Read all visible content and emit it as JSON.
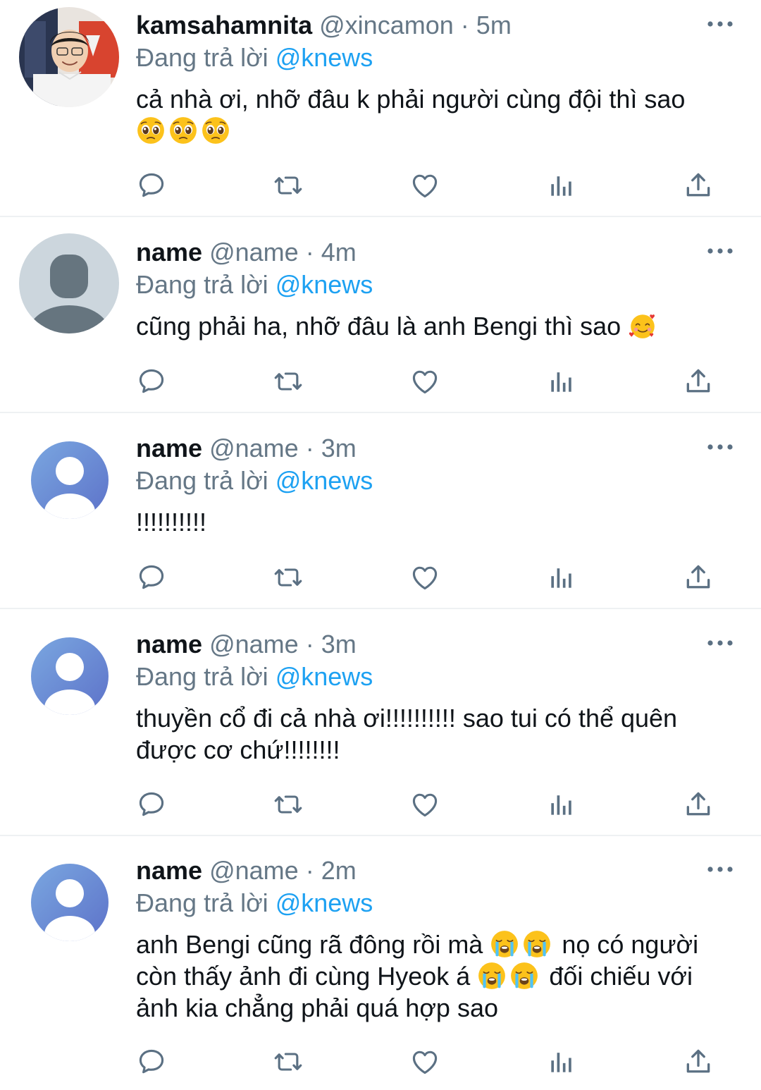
{
  "colors": {
    "accent": "#1da1f2",
    "text": "#0f1419",
    "muted": "#657786",
    "icon": "#5b7083",
    "divider": "#eef1f3"
  },
  "reply_prefix": "Đang trả lời",
  "tweets": [
    {
      "display_name": "kamsahamnita",
      "handle": "@xincamon",
      "separator": "·",
      "time": "5m",
      "reply_to": "@knews",
      "text_parts": [
        "cả nhà ơi, nhỡ đâu k phải người cùng đội thì sao\n",
        ""
      ],
      "emojis": [
        "pleading-face",
        "pleading-face",
        "pleading-face"
      ],
      "avatar": "photo"
    },
    {
      "display_name": "name",
      "handle": "@name",
      "separator": "·",
      "time": "4m",
      "reply_to": "@knews",
      "text": "cũng phải ha, nhỡ đâu là anh Bengi thì sao ",
      "emojis": [
        "smiling-face-with-hearts"
      ],
      "avatar": "default-gray"
    },
    {
      "display_name": "name",
      "handle": "@name",
      "separator": "·",
      "time": "3m",
      "reply_to": "@knews",
      "text": "!!!!!!!!!!",
      "avatar": "default-blue"
    },
    {
      "display_name": "name",
      "handle": "@name",
      "separator": "·",
      "time": "3m",
      "reply_to": "@knews",
      "text": "thuyền cổ đi cả nhà ơi!!!!!!!!!! sao tui có thể quên được cơ chứ!!!!!!!!",
      "avatar": "default-blue"
    },
    {
      "display_name": "name",
      "handle": "@name",
      "separator": "·",
      "time": "2m",
      "reply_to": "@knews",
      "text_a": "anh Bengi cũng rã đông rồi mà ",
      "text_b": " nọ có người còn thấy ảnh đi cùng Hyeok á ",
      "text_c": " đối chiếu với ảnh kia chẳng phải quá hợp sao",
      "emojis": [
        "loudly-crying-face",
        "loudly-crying-face"
      ],
      "avatar": "default-blue"
    }
  ],
  "action_icons": [
    "reply-icon",
    "retweet-icon",
    "like-icon",
    "analytics-icon",
    "share-icon"
  ]
}
